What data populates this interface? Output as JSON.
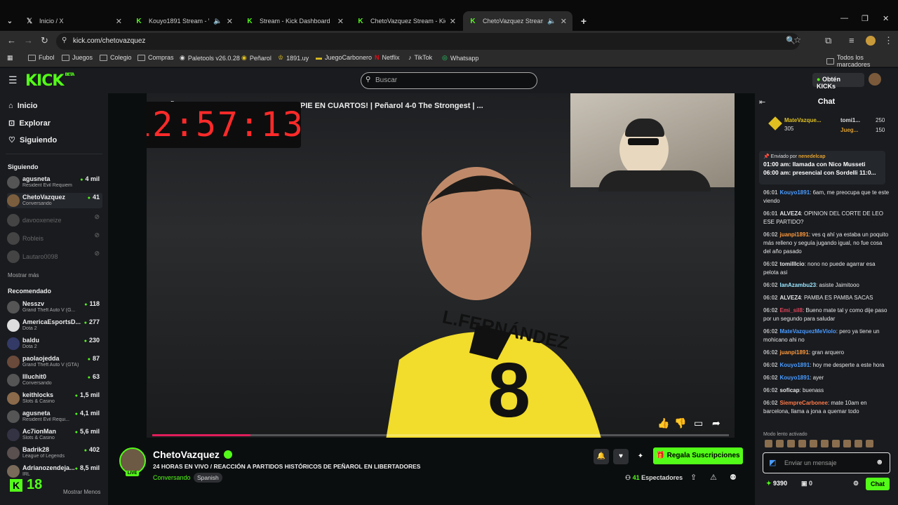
{
  "browser": {
    "tabs": [
      {
        "label": "Inicio / X",
        "favicon": "x-icon"
      },
      {
        "label": "Kouyo1891 Stream - Watch",
        "favicon": "kick-icon"
      },
      {
        "label": "Stream - Kick Dashboard",
        "favicon": "kick-icon"
      },
      {
        "label": "ChetoVazquez Stream - Kick Da",
        "favicon": "kick-icon"
      },
      {
        "label": "ChetoVazquez Stream - W",
        "favicon": "kick-icon",
        "active": true
      }
    ],
    "url": "kick.com/chetovazquez",
    "bookmarks": [
      "Fubol",
      "Juegos",
      "Colegio",
      "Compras",
      "Paletools v26.0.28",
      "Peñarol",
      "1891.uy",
      "JuegoCarbonero",
      "Netflix",
      "TikTok",
      "Whatsapp"
    ],
    "all_bookmarks": "Todos los marcadores"
  },
  "header": {
    "logo": "KICK",
    "logo_badge": "BETA",
    "search_placeholder": "Buscar",
    "kicks_button": "Obtén KICKs"
  },
  "sidebar": {
    "nav": [
      "Inicio",
      "Explorar",
      "Siguiendo"
    ],
    "following_header": "Siguiendo",
    "following": [
      {
        "name": "agusneta",
        "category": "Resident Evil Requiem",
        "viewers": "4 mil"
      },
      {
        "name": "ChetoVazquez",
        "category": "Conversando",
        "viewers": "41"
      },
      {
        "name": "davooxeneize",
        "category": "",
        "viewers": ""
      },
      {
        "name": "Robleis",
        "category": "",
        "viewers": ""
      },
      {
        "name": "Lautaro0098",
        "category": "",
        "viewers": ""
      }
    ],
    "show_more": "Mostrar más",
    "recommended_header": "Recomendado",
    "recommended": [
      {
        "name": "Nesszv",
        "category": "Grand Theft Auto V (G...",
        "viewers": "118"
      },
      {
        "name": "AmericaEsportsD...",
        "category": "Dota 2",
        "viewers": "277"
      },
      {
        "name": "baldu",
        "category": "Dota 2",
        "viewers": "230"
      },
      {
        "name": "paolaojedda",
        "category": "Grand Theft Auto V (GTA)",
        "viewers": "87"
      },
      {
        "name": "Illuchit0",
        "category": "Conversando",
        "viewers": "63"
      },
      {
        "name": "keithlocks",
        "category": "Slots & Casino",
        "viewers": "1,5 mil"
      },
      {
        "name": "agusneta",
        "category": "Resident Evil Requi...",
        "viewers": "4,1 mil"
      },
      {
        "name": "Ac7ionMan",
        "category": "Slots & Casino",
        "viewers": "5,6 mil"
      },
      {
        "name": "Badrik28",
        "category": "League of Legends",
        "viewers": "402"
      },
      {
        "name": "Adrianozendeja...",
        "category": "IRL",
        "viewers": "8,5 mil"
      }
    ],
    "show_less": "Mostrar Menos",
    "corner_badge": "18"
  },
  "video": {
    "overlay_title": "PEÑAROL 4-0 THE STRONGEST | ¡UN PIE EN CUARTOS! | Peñarol 4-0 The Strongest | ...",
    "clock": "12:57:13",
    "jersey_name": "L.FERNÁNDEZ",
    "jersey_number": "8",
    "progress_fraction": 0.17
  },
  "stream_info": {
    "channel_name": "ChetoVazquez",
    "live_badge": "LIVE",
    "title": "24 HORAS EN VIVO / REACCIÓN A PARTIDOS HISTÓRICOS DE PEÑAROL EN LIBERTADORES",
    "category": "Conversando",
    "tag": "Spanish",
    "subscribe_button": "Regala Suscripciones",
    "viewer_count": "41",
    "viewer_label": "Espectadores"
  },
  "chat": {
    "header": "Chat",
    "leaderboard": [
      {
        "name": "MateVazque...",
        "value": "305"
      },
      {
        "name": "tomi1...",
        "value": "250"
      },
      {
        "name": "Jueg...",
        "value": "150"
      }
    ],
    "pinned_by_label": "Enviado por",
    "pinned_by_user": "nenedelcap",
    "pinned_lines": [
      "01:00 am: llamada con Nico Musseti",
      "06:00 am: presencial con Sordelli 11:0..."
    ],
    "messages": [
      {
        "time": "06:01",
        "user": "Kouyo1891",
        "color": "#4a9bff",
        "text": "6am, me preocupa que te este viendo"
      },
      {
        "time": "06:01",
        "user": "ALVEZ4",
        "color": "#e6e6e6",
        "text": "OPINION DEL CORTE DE LEO ESE PARTIDO?"
      },
      {
        "time": "06:02",
        "user": "juanpi1891",
        "color": "#ff9a3d",
        "text": "ves q ahí ya estaba un poquito más relleno y seguía jugando igual, no fue cosa del año pasado"
      },
      {
        "time": "06:02",
        "user": "tomilllcio",
        "color": "#e6e6e6",
        "text": "nono no puede agarrar esa pelota asi"
      },
      {
        "time": "06:02",
        "user": "IanAzambu23",
        "color": "#9be7ff",
        "text": "asiste Jaimitooo"
      },
      {
        "time": "06:02",
        "user": "ALVEZ4",
        "color": "#e6e6e6",
        "text": "PAMBA ES PAMBA SACAS"
      },
      {
        "time": "06:02",
        "user": "Emi_sil8",
        "color": "#e0445a",
        "text": "Bueno mate tal y como dije paso por un segundo para saludar"
      },
      {
        "time": "06:02",
        "user": "MateVazquezMeViolo",
        "color": "#4a9bff",
        "text": "pero ya tiene un mohicano ahi no"
      },
      {
        "time": "06:02",
        "user": "juanpi1891",
        "color": "#ff9a3d",
        "text": "gran arquero"
      },
      {
        "time": "06:02",
        "user": "Kouyo1891",
        "color": "#4a9bff",
        "text": "hoy me desperte a este hora"
      },
      {
        "time": "06:02",
        "user": "Kouyo1891",
        "color": "#4a9bff",
        "text": "ayer"
      },
      {
        "time": "06:02",
        "user": "soficap",
        "color": "#e6e6e6",
        "text": "buenass"
      },
      {
        "time": "06:02",
        "user": "SiempreCarbonee",
        "color": "#ff7a4a",
        "text": "mate 10am en barcelona, llama a jona a quemar todo"
      }
    ],
    "slow_mode": "Modo lento activado",
    "input_placeholder": "Enviar un mensaje",
    "kicks_balance": "9390",
    "gift_count": "0",
    "send_button": "Chat"
  },
  "colors": {
    "accent": "#53fc18",
    "background": "#0b0e0f",
    "panel": "#191b1f"
  }
}
